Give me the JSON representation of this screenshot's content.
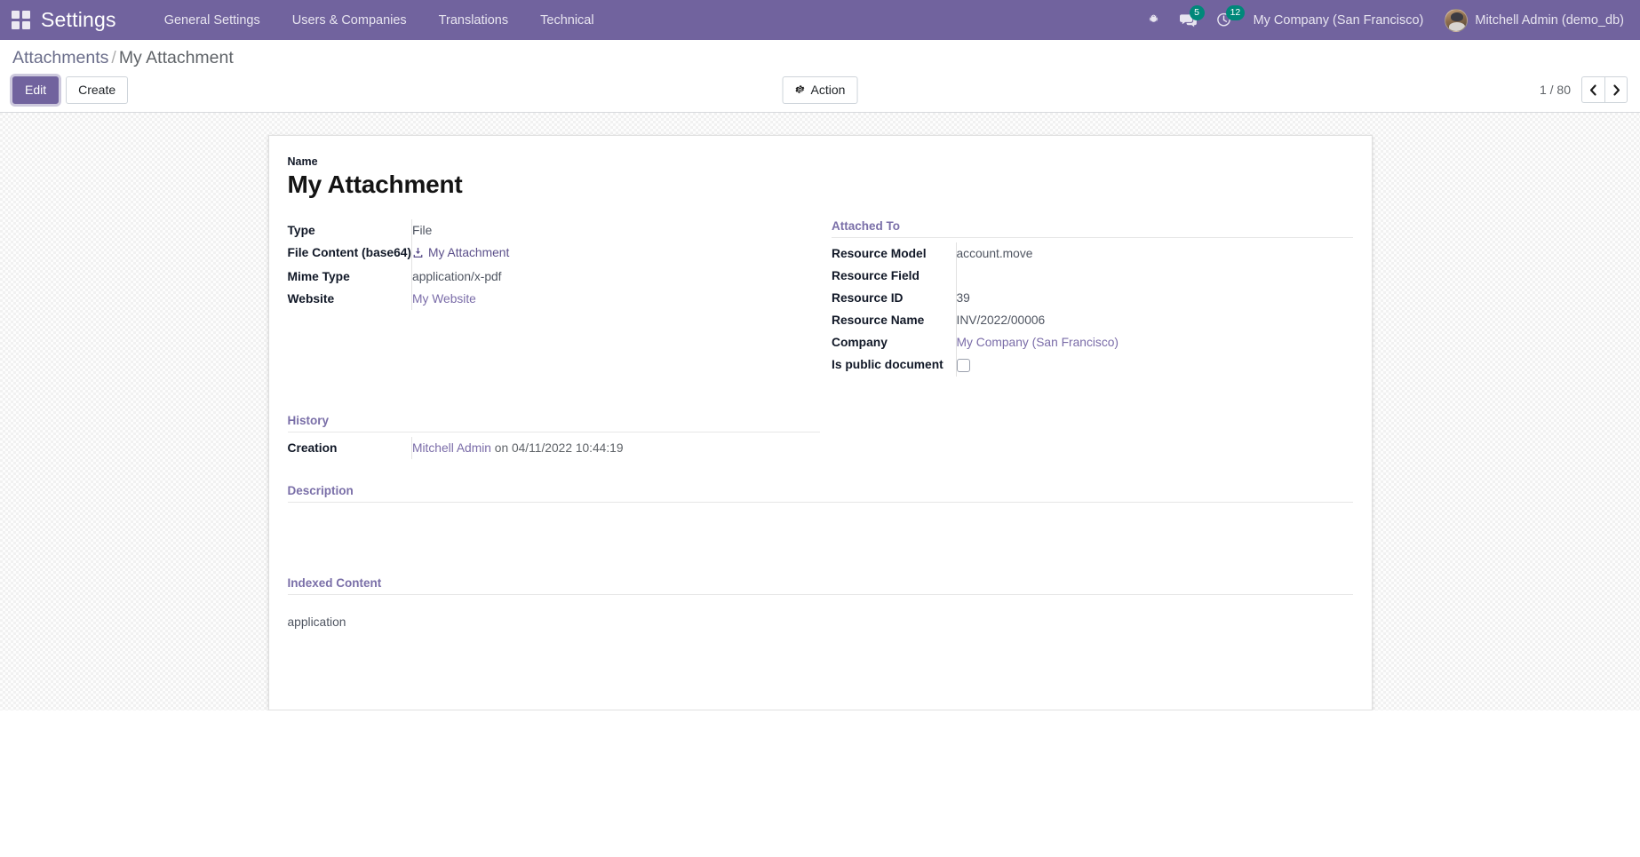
{
  "navbar": {
    "apps_icon": "apps-grid-icon",
    "brand": "Settings",
    "menu_items": [
      {
        "label": "General Settings"
      },
      {
        "label": "Users & Companies"
      },
      {
        "label": "Translations"
      },
      {
        "label": "Technical"
      }
    ],
    "icons": [
      {
        "name": "bug-icon",
        "badge": null
      },
      {
        "name": "messages-icon",
        "badge": "5"
      },
      {
        "name": "activity-clock-icon",
        "badge": "12"
      }
    ],
    "company": "My Company (San Francisco)",
    "user": "Mitchell Admin (demo_db)",
    "accent_color": "#71639e",
    "badge_color": "#00887a"
  },
  "control_panel": {
    "breadcrumb_root": "Attachments",
    "breadcrumb_sep": "/",
    "breadcrumb_current": "My Attachment",
    "edit_label": "Edit",
    "create_label": "Create",
    "action_label": "Action",
    "action_icon": "gear-icon",
    "pager_value": "1 / 80",
    "prev_icon": "chevron-left-icon",
    "next_icon": "chevron-right-icon"
  },
  "form": {
    "name_label": "Name",
    "name_value": "My Attachment",
    "left_fields": [
      {
        "label": "Type",
        "value": "File",
        "kind": "text"
      },
      {
        "label": "File Content (base64)",
        "value": "My Attachment",
        "kind": "download-link"
      },
      {
        "label": "Mime Type",
        "value": "application/x-pdf",
        "kind": "text"
      },
      {
        "label": "Website",
        "value": "My Website",
        "kind": "link"
      }
    ],
    "attached_to": {
      "title": "Attached To",
      "fields": [
        {
          "label": "Resource Model",
          "value": "account.move",
          "kind": "text"
        },
        {
          "label": "Resource Field",
          "value": "",
          "kind": "text"
        },
        {
          "label": "Resource ID",
          "value": "39",
          "kind": "text"
        },
        {
          "label": "Resource Name",
          "value": "INV/2022/00006",
          "kind": "text"
        },
        {
          "label": "Company",
          "value": "My Company (San Francisco)",
          "kind": "link"
        },
        {
          "label": "Is public document",
          "value": "",
          "kind": "checkbox"
        }
      ]
    },
    "history": {
      "title": "History",
      "creation_label": "Creation",
      "creation_user": "Mitchell Admin",
      "creation_suffix": " on 04/11/2022 10:44:19"
    },
    "description": {
      "title": "Description",
      "value": ""
    },
    "indexed_content": {
      "title": "Indexed Content",
      "value": "application"
    }
  }
}
